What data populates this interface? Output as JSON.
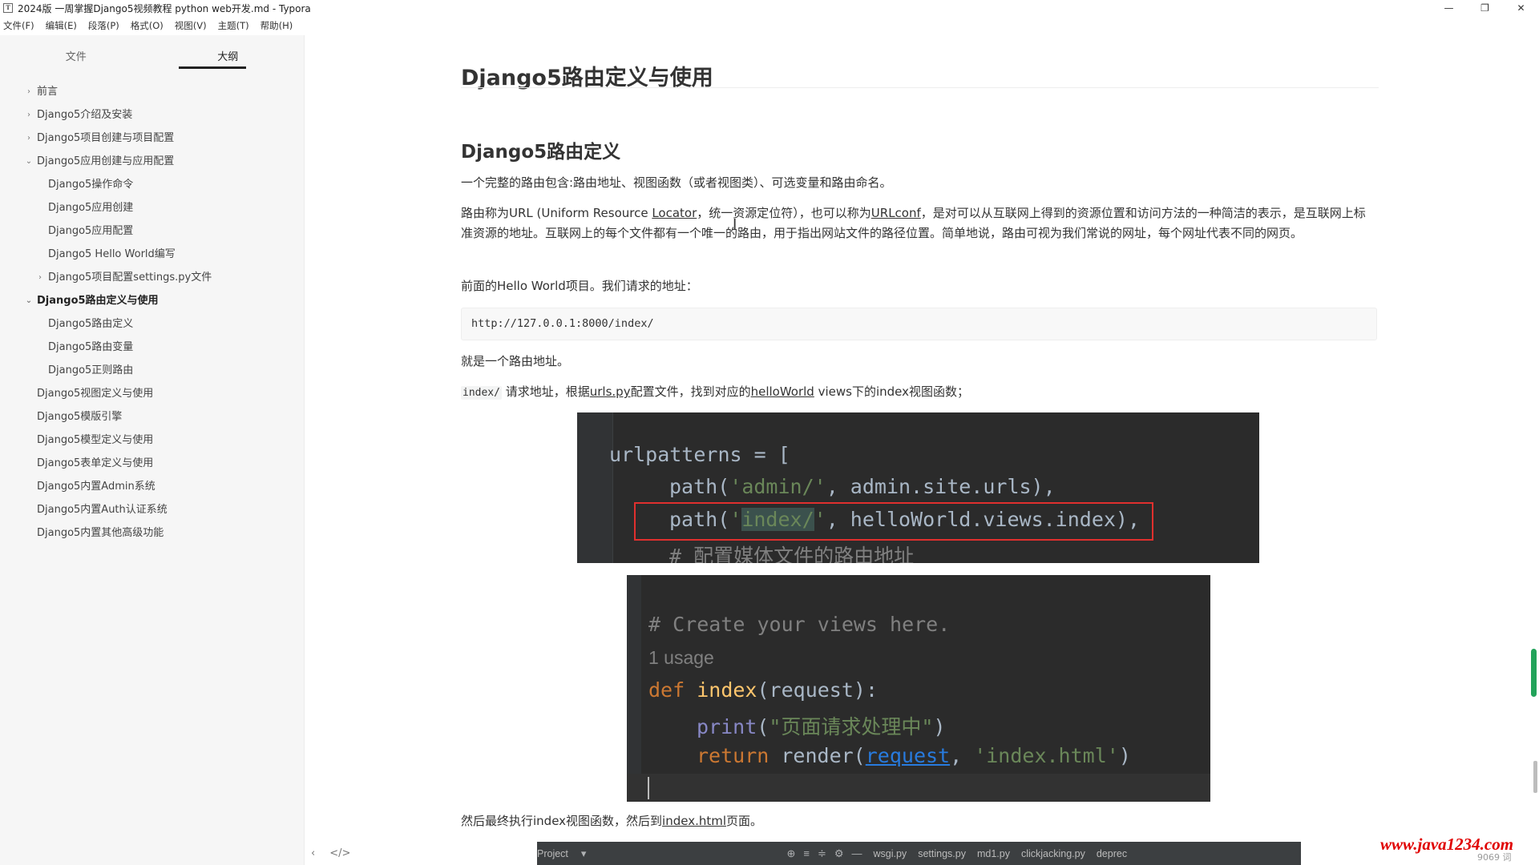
{
  "window": {
    "title": "2024版 一周掌握Django5视频教程 python web开发.md - Typora",
    "app_icon": "T",
    "controls": {
      "minimize": "—",
      "maximize": "❐",
      "close": "✕"
    }
  },
  "menu": [
    "文件(F)",
    "编辑(E)",
    "段落(P)",
    "格式(O)",
    "视图(V)",
    "主题(T)",
    "帮助(H)"
  ],
  "sidebar": {
    "tabs": [
      {
        "label": "文件",
        "active": false
      },
      {
        "label": "大纲",
        "active": true
      }
    ],
    "outline": [
      {
        "label": "前言",
        "level": 0,
        "chevron": "›",
        "bold": false
      },
      {
        "label": "Django5介绍及安装",
        "level": 0,
        "chevron": "›",
        "bold": false
      },
      {
        "label": "Django5项目创建与项目配置",
        "level": 0,
        "chevron": "›",
        "bold": false
      },
      {
        "label": "Django5应用创建与应用配置",
        "level": 0,
        "chevron": "⌄",
        "bold": false
      },
      {
        "label": "Django5操作命令",
        "level": 1,
        "chevron": "",
        "bold": false
      },
      {
        "label": "Django5应用创建",
        "level": 1,
        "chevron": "",
        "bold": false
      },
      {
        "label": "Django5应用配置",
        "level": 1,
        "chevron": "",
        "bold": false
      },
      {
        "label": "Django5 Hello World编写",
        "level": 1,
        "chevron": "",
        "bold": false
      },
      {
        "label": "Django5项目配置settings.py文件",
        "level": 1,
        "chevron": "›",
        "bold": false
      },
      {
        "label": "Django5路由定义与使用",
        "level": 0,
        "chevron": "⌄",
        "bold": true
      },
      {
        "label": "Django5路由定义",
        "level": 1,
        "chevron": "",
        "bold": false
      },
      {
        "label": "Django5路由变量",
        "level": 1,
        "chevron": "",
        "bold": false
      },
      {
        "label": "Django5正则路由",
        "level": 1,
        "chevron": "",
        "bold": false
      },
      {
        "label": "Django5视图定义与使用",
        "level": 0,
        "chevron": "",
        "bold": false
      },
      {
        "label": "Django5模版引擎",
        "level": 0,
        "chevron": "",
        "bold": false
      },
      {
        "label": "Django5模型定义与使用",
        "level": 0,
        "chevron": "",
        "bold": false
      },
      {
        "label": "Django5表单定义与使用",
        "level": 0,
        "chevron": "",
        "bold": false
      },
      {
        "label": "Django5内置Admin系统",
        "level": 0,
        "chevron": "",
        "bold": false
      },
      {
        "label": "Django5内置Auth认证系统",
        "level": 0,
        "chevron": "",
        "bold": false
      },
      {
        "label": "Django5内置其他高级功能",
        "level": 0,
        "chevron": "",
        "bold": false
      }
    ],
    "footer": {
      "collapse": "‹",
      "source": "</>"
    }
  },
  "doc": {
    "h1": "Django5路由定义与使用",
    "h2": "Django5路由定义",
    "p1": "一个完整的路由包含:路由地址、视图函数（或者视图类）、可选变量和路由命名。",
    "p2": {
      "a": "路由称为URL (Uniform Resource ",
      "b": "Locator",
      "c": "，统一资源定位符），也可以称为",
      "d": "URLconf",
      "e": "，是对可以从互联网上得到的资源位置和访问方法的一种简洁的表示，是互联网上标准资源的地址。互联网上的每个文件都有一个唯一的路由，用于指出网站文件的路径位置。简单地说，路由可视为我们常说的网址，每个网址代表不同的网页。"
    },
    "p3": "前面的Hello World项目。我们请求的地址：",
    "code": "http://127.0.0.1:8000/index/",
    "p4": "就是一个路由地址。",
    "p5": {
      "code": "index/",
      "a": " 请求地址，根据",
      "b": "urls.py",
      "c": "配置文件，找到对应的",
      "d": "helloWorld",
      "e": " views下的index视图函数；"
    },
    "p6": {
      "a": "然后最终执行index视图函数，然后到",
      "b": "index.html",
      "c": "页面。"
    }
  },
  "img1": {
    "l1": "urlpatterns = [",
    "l2a": "path(",
    "l2b": "'admin/'",
    "l2c": ", admin.site.urls),",
    "l3a": "path(",
    "l3b": "'",
    "l3c": "index/",
    "l3d": "'",
    "l3e": ", helloWorld.views.index),",
    "l4": "# 配置媒体文件的路由地址"
  },
  "img2": {
    "l1": "# Create your views here.",
    "l2": "1 usage",
    "l3a": "def",
    "l3b": "index",
    "l3c": "(request):",
    "l4a": "print",
    "l4b": "(",
    "l4c": "\"页面请求处理中\"",
    "l4d": ")",
    "l5a": "return",
    "l5b": " render(",
    "l5c": "request",
    "l5d": ", ",
    "l5e": "'index.html'",
    "l5f": ")"
  },
  "img3": {
    "project": "Project",
    "dropdown": "▾",
    "icons": [
      "⊕",
      "≡",
      "≑",
      "⚙",
      "—"
    ],
    "tabs": [
      "wsgi.py",
      "settings.py",
      "md1.py",
      "clickjacking.py",
      "deprec"
    ]
  },
  "watermark": "www.java1234.com",
  "word_count": "9069 词",
  "colors": {
    "highlight_box": "#e0302e",
    "watermark": "#e00000",
    "scroll_thumb": "#22a35a"
  }
}
